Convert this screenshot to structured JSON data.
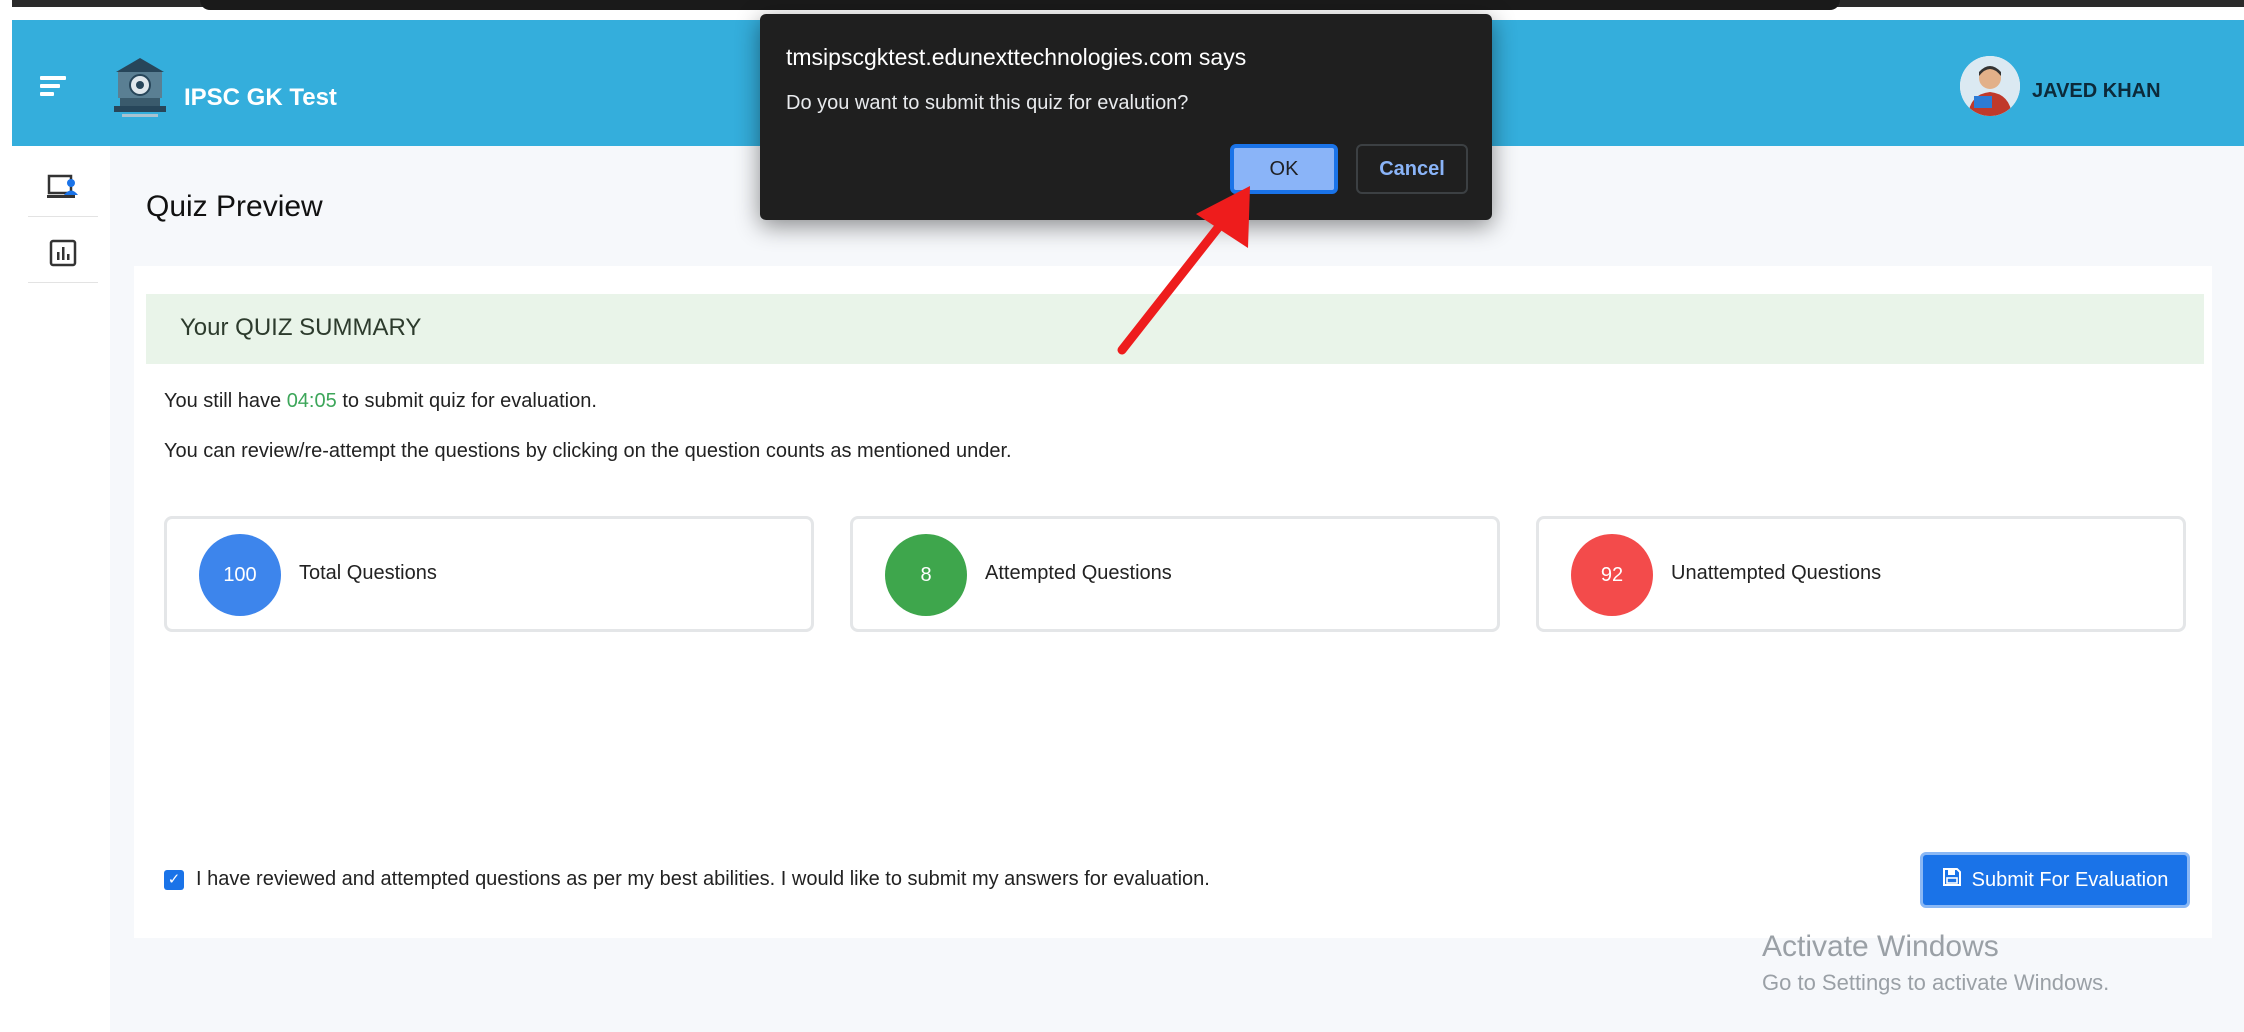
{
  "header": {
    "app_title": "IPSC GK Test",
    "user_name": "JAVED KHAN"
  },
  "sidebar": {
    "items": [
      {
        "icon": "monitor-user-icon"
      },
      {
        "icon": "bar-chart-icon"
      }
    ]
  },
  "page": {
    "title": "Quiz Preview"
  },
  "summary": {
    "heading": "Your QUIZ SUMMARY",
    "time_prefix": "You still have",
    "time_left": "04:05",
    "time_suffix": "to submit quiz for evaluation.",
    "review_text": "You can review/re-attempt the questions by clicking on the question counts as mentioned under.",
    "stats": [
      {
        "count": "100",
        "label": "Total Questions",
        "color": "#3d85ec"
      },
      {
        "count": "8",
        "label": "Attempted Questions",
        "color": "#3ea64c"
      },
      {
        "count": "92",
        "label": "Unattempted Questions",
        "color": "#f34b4b"
      }
    ],
    "agree_checked": true,
    "agree_text": "I have reviewed and attempted questions as per my best abilities. I would like to submit my answers for evaluation.",
    "submit_label": "Submit For Evaluation"
  },
  "dialog": {
    "origin": "tmsipscgktest.edunexttechnologies.com says",
    "message": "Do you want to submit this quiz for evalution?",
    "ok_label": "OK",
    "cancel_label": "Cancel"
  },
  "watermark": {
    "line1": "Activate Windows",
    "line2": "Go to Settings to activate Windows."
  },
  "colors": {
    "header_bg": "#34aedc",
    "summary_bg": "#e9f4e9",
    "primary": "#1a73e8",
    "time_green": "#3da65a",
    "annotation_arrow": "#ee1c1c"
  }
}
